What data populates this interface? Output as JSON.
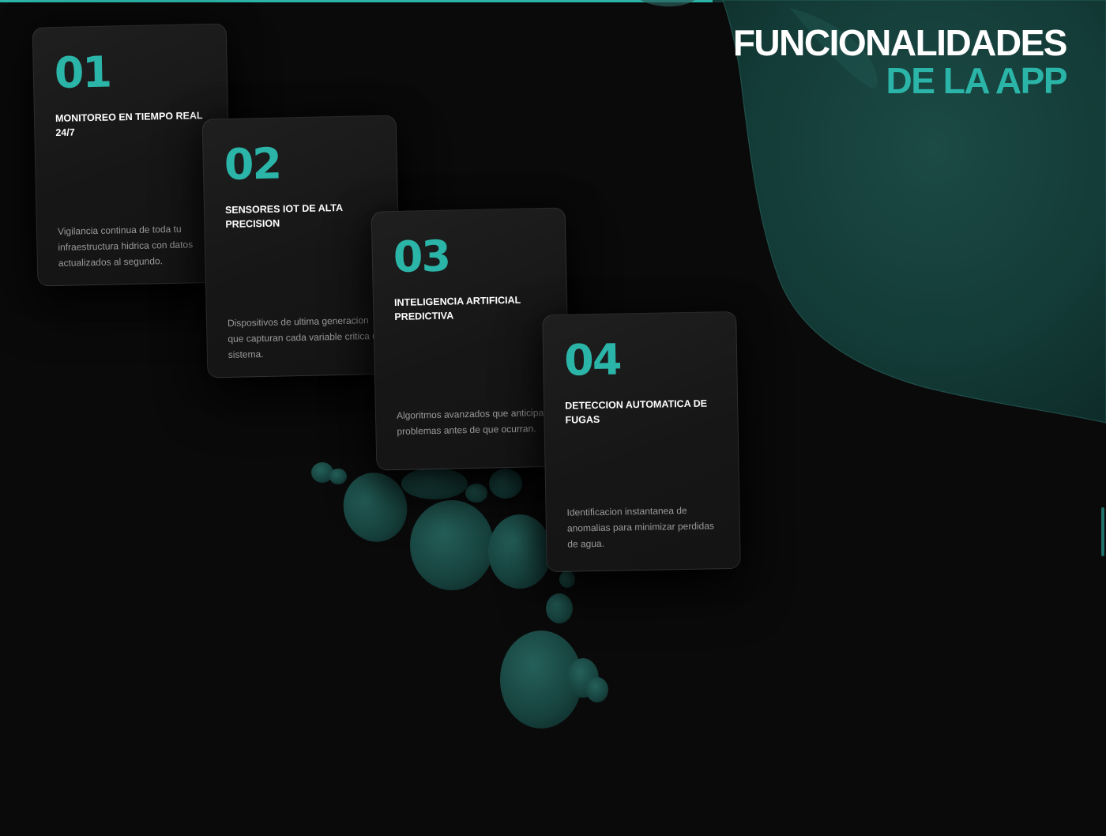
{
  "progress": {
    "value_percent": 64.4,
    "color": "#2bb5a8"
  },
  "title": {
    "line1": "FUNCIONALIDADES",
    "line2": "DE LA APP",
    "accent_color": "#2bb5a8"
  },
  "cards": [
    {
      "number": "01",
      "heading": "MONITOREO EN TIEMPO REAL 24/7",
      "description": "Vigilancia continua de toda tu infraestructura hidrica con datos actualizados al segundo."
    },
    {
      "number": "02",
      "heading": "SENSORES IOT DE ALTA PRECISION",
      "description": "Dispositivos de ultima generacion que capturan cada variable critica del sistema."
    },
    {
      "number": "03",
      "heading": "INTELIGENCIA ARTIFICIAL PREDICTIVA",
      "description": "Algoritmos avanzados que anticipan problemas antes de que ocurran."
    },
    {
      "number": "04",
      "heading": "DETECCION AUTOMATICA DE FUGAS",
      "description": "Identificacion instantanea de anomalias para minimizar perdidas de agua."
    }
  ],
  "colors": {
    "background": "#0a0a0a",
    "card": "#1a1a1a",
    "accent": "#2bb5a8",
    "blob": "#143a36"
  }
}
